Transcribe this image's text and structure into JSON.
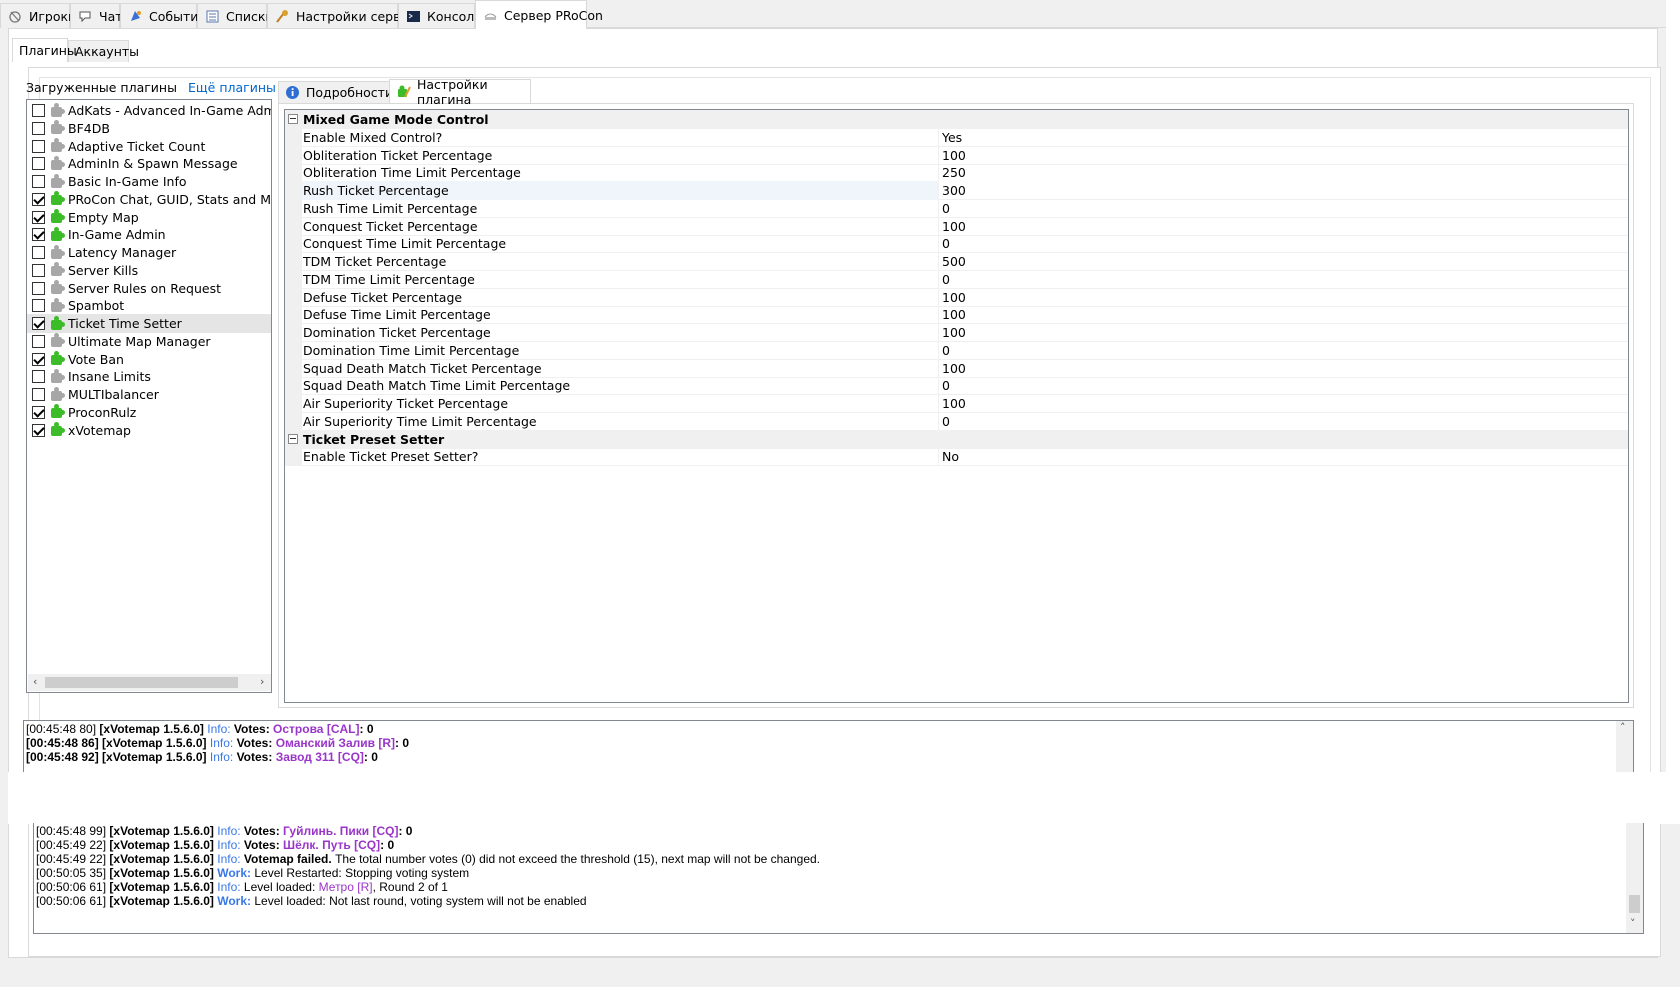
{
  "main_tabs": [
    {
      "label": "Игроки",
      "icon": "players-icon"
    },
    {
      "label": "Чат",
      "icon": "chat-icon"
    },
    {
      "label": "События",
      "icon": "events-icon"
    },
    {
      "label": "Списки",
      "icon": "lists-icon"
    },
    {
      "label": "Настройки сервера",
      "icon": "server-settings-icon"
    },
    {
      "label": "Консоль",
      "icon": "console-icon"
    },
    {
      "label": "Сервер PRoCon",
      "icon": "procon-server-icon"
    }
  ],
  "active_main_tab": "Сервер PRoCon",
  "sub_tabs": [
    {
      "label": "Плагины"
    },
    {
      "label": "Аккаунты"
    }
  ],
  "plugins_panel": {
    "loaded_label": "Загруженные плагины",
    "more_link": "Ещё плагины",
    "items": [
      {
        "label": "AdKats - Advanced In-Game Admin",
        "checked": false
      },
      {
        "label": "BF4DB",
        "checked": false
      },
      {
        "label": "Adaptive Ticket Count",
        "checked": false
      },
      {
        "label": "AdminIn & Spawn Message",
        "checked": false
      },
      {
        "label": "Basic In-Game Info",
        "checked": false
      },
      {
        "label": "PRoCon Chat, GUID, Stats and Map Logger",
        "checked": true
      },
      {
        "label": "Empty Map",
        "checked": true
      },
      {
        "label": "In-Game Admin",
        "checked": true
      },
      {
        "label": "Latency Manager",
        "checked": false
      },
      {
        "label": "Server Kills",
        "checked": false
      },
      {
        "label": "Server Rules on Request",
        "checked": false
      },
      {
        "label": "Spambot",
        "checked": false
      },
      {
        "label": "Ticket Time Setter",
        "checked": true
      },
      {
        "label": "Ultimate Map Manager",
        "checked": false
      },
      {
        "label": "Vote Ban",
        "checked": true
      },
      {
        "label": "Insane Limits",
        "checked": false
      },
      {
        "label": "MULTIbalancer",
        "checked": false
      },
      {
        "label": "ProconRulz",
        "checked": true
      },
      {
        "label": "xVotemap",
        "checked": true
      }
    ],
    "selected": "Ticket Time Setter"
  },
  "detail_tabs": [
    {
      "label": "Подробности",
      "icon": "info-icon"
    },
    {
      "label": "Настройки плагина",
      "icon": "plugin-settings-icon"
    }
  ],
  "settings": [
    {
      "category": "Mixed Game Mode Control",
      "rows": [
        {
          "name": "Enable Mixed Control?",
          "value": "Yes"
        },
        {
          "name": "Obliteration Ticket Percentage",
          "value": "100"
        },
        {
          "name": "Obliteration Time Limit Percentage",
          "value": "250"
        },
        {
          "name": "Rush Ticket Percentage",
          "value": "300"
        },
        {
          "name": "Rush Time Limit Percentage",
          "value": "0"
        },
        {
          "name": "Conquest Ticket Percentage",
          "value": "100"
        },
        {
          "name": "Conquest Time Limit Percentage",
          "value": "0"
        },
        {
          "name": "TDM Ticket Percentage",
          "value": "500"
        },
        {
          "name": "TDM Time Limit Percentage",
          "value": "0"
        },
        {
          "name": "Defuse Ticket Percentage",
          "value": "100"
        },
        {
          "name": "Defuse Time Limit Percentage",
          "value": "100"
        },
        {
          "name": "Domination Ticket Percentage",
          "value": "100"
        },
        {
          "name": "Domination Time Limit Percentage",
          "value": "0"
        },
        {
          "name": "Squad Death Match Ticket Percentage",
          "value": "100"
        },
        {
          "name": "Squad Death Match Time Limit Percentage",
          "value": "0"
        },
        {
          "name": "Air Superiority Ticket Percentage",
          "value": "100"
        },
        {
          "name": "Air Superiority Time Limit Percentage",
          "value": "0"
        }
      ]
    },
    {
      "category": "Ticket Preset Setter",
      "rows": [
        {
          "name": "Enable Ticket Preset Setter?",
          "value": "No"
        }
      ]
    }
  ],
  "selected_setting": "Rush Ticket Percentage",
  "console_top": [
    [
      {
        "t": "[00:45:48 80] "
      },
      {
        "t": "[xVotemap 1.5.6.0] ",
        "c": "b"
      },
      {
        "t": "Info: ",
        "c": "info"
      },
      {
        "t": "Votes: ",
        "c": "b"
      },
      {
        "t": "Острова [CAL]",
        "c": "map"
      },
      {
        "t": ": 0",
        "c": "b"
      }
    ],
    [
      {
        "t": "[00:45:48 86] ",
        "c": "b"
      },
      {
        "t": "[xVotemap 1.5.6.0] ",
        "c": "b"
      },
      {
        "t": "Info: ",
        "c": "info"
      },
      {
        "t": "Votes: ",
        "c": "b"
      },
      {
        "t": "Оманский Залив [R]",
        "c": "map"
      },
      {
        "t": ": 0",
        "c": "b"
      }
    ],
    [
      {
        "t": "[00:45:48 92] ",
        "c": "b"
      },
      {
        "t": "[xVotemap 1.5.6.0] ",
        "c": "b"
      },
      {
        "t": "Info: ",
        "c": "info"
      },
      {
        "t": "Votes: ",
        "c": "b"
      },
      {
        "t": "Завод 311 [CQ]",
        "c": "map"
      },
      {
        "t": ": 0",
        "c": "b"
      }
    ]
  ],
  "console_bottom": [
    [
      {
        "t": "[00:45:48 99] "
      },
      {
        "t": "[xVotemap 1.5.6.0] ",
        "c": "b"
      },
      {
        "t": "Info: ",
        "c": "info"
      },
      {
        "t": "Votes: ",
        "c": "b"
      },
      {
        "t": "Гуйлинь. Пики [CQ]",
        "c": "map"
      },
      {
        "t": ": 0",
        "c": "b"
      }
    ],
    [
      {
        "t": "[00:45:49 22] "
      },
      {
        "t": "[xVotemap 1.5.6.0] ",
        "c": "b"
      },
      {
        "t": "Info: ",
        "c": "info"
      },
      {
        "t": "Votes: ",
        "c": "b"
      },
      {
        "t": "Шёлк. Путь [CQ]",
        "c": "map"
      },
      {
        "t": ": 0",
        "c": "b"
      }
    ],
    [
      {
        "t": "[00:45:49 22] "
      },
      {
        "t": "[xVotemap 1.5.6.0] ",
        "c": "b"
      },
      {
        "t": "Info: ",
        "c": "info"
      },
      {
        "t": "Votemap failed. ",
        "c": "b"
      },
      {
        "t": "The total number votes (0) did not exceed the threshold (15), next map will not be changed."
      }
    ],
    [
      {
        "t": "[00:50:05 35] "
      },
      {
        "t": "[xVotemap 1.5.6.0] ",
        "c": "b"
      },
      {
        "t": "Work: ",
        "c": "work"
      },
      {
        "t": "Level Restarted: Stopping voting system"
      }
    ],
    [
      {
        "t": "[00:50:06 61] "
      },
      {
        "t": "[xVotemap 1.5.6.0] ",
        "c": "b"
      },
      {
        "t": "Info: ",
        "c": "info"
      },
      {
        "t": "Level loaded: "
      },
      {
        "t": "Метро [R]",
        "c": "mapn"
      },
      {
        "t": ", Round 2 of 1"
      }
    ],
    [
      {
        "t": "[00:50:06 61] "
      },
      {
        "t": "[xVotemap 1.5.6.0] ",
        "c": "b"
      },
      {
        "t": "Work: ",
        "c": "work"
      },
      {
        "t": "Level loaded: Not last round, voting system will not be enabled"
      }
    ]
  ],
  "colors": {
    "info": "#3a78e6",
    "map": "#9a35c9",
    "plugin_enabled": "#3cbc28",
    "plugin_disabled": "#a7a7a7"
  }
}
